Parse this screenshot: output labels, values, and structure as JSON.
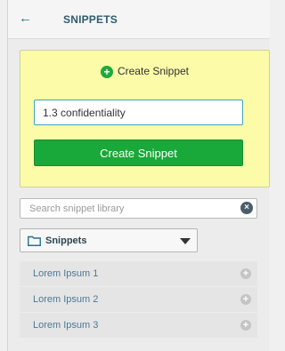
{
  "header": {
    "back_icon": "arrow-left-icon",
    "title": "SNIPPETS"
  },
  "create": {
    "heading": "Create Snippet",
    "heading_icon": "plus-circle-icon",
    "name_value": "1.3 confidentiality",
    "button_label": "Create Snippet",
    "accent_color": "#19a83a",
    "box_color": "#fbfba8"
  },
  "search": {
    "placeholder": "Search snippet library",
    "clear_icon": "clear-icon"
  },
  "folder": {
    "icon": "folder-icon",
    "selected": "Snippets",
    "caret_icon": "caret-down-icon"
  },
  "snippets": [
    {
      "label": "Lorem Ipsum 1",
      "icon": "add-circle-icon"
    },
    {
      "label": "Lorem Ipsum 2",
      "icon": "add-circle-icon"
    },
    {
      "label": "Lorem Ipsum 3",
      "icon": "add-circle-icon"
    }
  ]
}
